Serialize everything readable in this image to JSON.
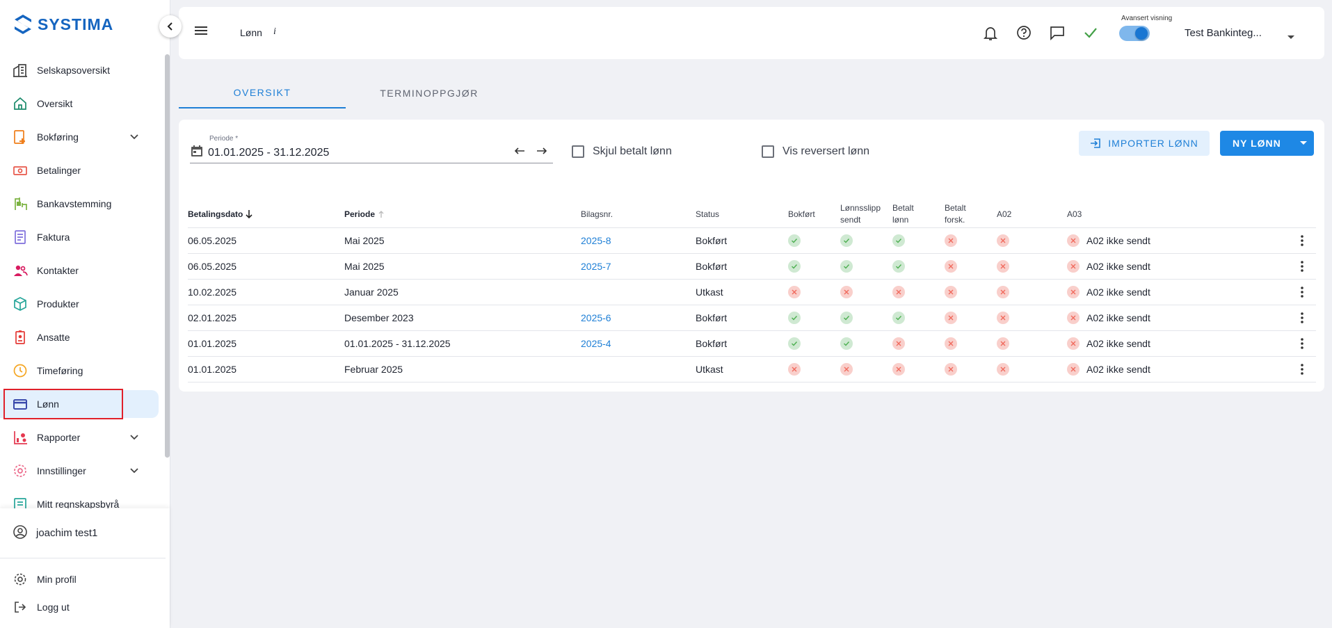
{
  "brand": {
    "name": "SYSTIMA",
    "color": "#1565c0"
  },
  "sidebar": {
    "items": [
      {
        "label": "Selskapsoversikt",
        "icon": "buildings-icon",
        "color": "#444444",
        "chevron": false
      },
      {
        "label": "Oversikt",
        "icon": "home-icon",
        "color": "#1b8a6b",
        "chevron": false
      },
      {
        "label": "Bokføring",
        "icon": "bookkeeping-icon",
        "color": "#ef7d18",
        "chevron": true
      },
      {
        "label": "Betalinger",
        "icon": "payments-icon",
        "color": "#e8574a",
        "chevron": false
      },
      {
        "label": "Bankavstemming",
        "icon": "reconcile-icon",
        "color": "#7cb342",
        "chevron": false
      },
      {
        "label": "Faktura",
        "icon": "invoice-icon",
        "color": "#7e6fdc",
        "chevron": false
      },
      {
        "label": "Kontakter",
        "icon": "contacts-icon",
        "color": "#d81b60",
        "chevron": false
      },
      {
        "label": "Produkter",
        "icon": "box-icon",
        "color": "#26a69a",
        "chevron": false
      },
      {
        "label": "Ansatte",
        "icon": "badge-icon",
        "color": "#e53935",
        "chevron": false
      },
      {
        "label": "Timeføring",
        "icon": "clock-icon",
        "color": "#f5a623",
        "chevron": false
      },
      {
        "label": "Lønn",
        "icon": "card-icon",
        "color": "#3949ab",
        "chevron": false,
        "active": true
      },
      {
        "label": "Rapporter",
        "icon": "chart-icon",
        "color": "#e53950",
        "chevron": true
      },
      {
        "label": "Innstillinger",
        "icon": "settings-icon",
        "color": "#ec6b8c",
        "chevron": true
      },
      {
        "label": "Mitt regnskapsbyrå",
        "icon": "agency-icon",
        "color": "#26a69a",
        "chevron": false
      }
    ],
    "user": "joachim test1",
    "profile": "Min profil",
    "logout": "Logg ut"
  },
  "header": {
    "title": "Lønn",
    "info": "i",
    "advanced_label": "Avansert visning",
    "advanced_on": true,
    "company": "Test Bankinteg..."
  },
  "tabs": [
    {
      "label": "OVERSIKT",
      "active": true
    },
    {
      "label": "TERMINOPPGJØR",
      "active": false
    }
  ],
  "filters": {
    "period_label": "Periode *",
    "period_value": "01.01.2025 - 31.12.2025",
    "hide_paid": "Skjul betalt lønn",
    "show_reversed": "Vis reversert lønn",
    "import_label": "IMPORTER LØNN",
    "new_label": "NY LØNN"
  },
  "table": {
    "headers": {
      "paydate": "Betalingsdato",
      "period": "Periode",
      "voucher": "Bilagsnr.",
      "status": "Status",
      "booked": "Bokført",
      "payslip_1": "Lønnsslipp",
      "payslip_2": "sendt",
      "paid_1": "Betalt",
      "paid_2": "lønn",
      "paid_adv_1": "Betalt",
      "paid_adv_2": "forsk.",
      "a02": "A02",
      "a03": "A03"
    },
    "rows": [
      {
        "paydate": "06.05.2025",
        "period": "Mai 2025",
        "voucher": "2025-8",
        "status": "Bokført",
        "booked": true,
        "payslip": true,
        "paid": true,
        "adv": false,
        "a02": false,
        "a03": "A02 ikke sendt"
      },
      {
        "paydate": "06.05.2025",
        "period": "Mai 2025",
        "voucher": "2025-7",
        "status": "Bokført",
        "booked": true,
        "payslip": true,
        "paid": true,
        "adv": false,
        "a02": false,
        "a03": "A02 ikke sendt"
      },
      {
        "paydate": "10.02.2025",
        "period": "Januar 2025",
        "voucher": "",
        "status": "Utkast",
        "booked": false,
        "payslip": false,
        "paid": false,
        "adv": false,
        "a02": false,
        "a03": "A02 ikke sendt"
      },
      {
        "paydate": "02.01.2025",
        "period": "Desember 2023",
        "voucher": "2025-6",
        "status": "Bokført",
        "booked": true,
        "payslip": true,
        "paid": true,
        "adv": false,
        "a02": false,
        "a03": "A02 ikke sendt"
      },
      {
        "paydate": "01.01.2025",
        "period": "01.01.2025 - 31.12.2025",
        "voucher": "2025-4",
        "status": "Bokført",
        "booked": true,
        "payslip": true,
        "paid": false,
        "adv": false,
        "a02": false,
        "a03": "A02 ikke sendt"
      },
      {
        "paydate": "01.01.2025",
        "period": "Februar 2025",
        "voucher": "",
        "status": "Utkast",
        "booked": false,
        "payslip": false,
        "paid": false,
        "adv": false,
        "a02": false,
        "a03": "A02 ikke sendt"
      }
    ]
  },
  "colors": {
    "accent": "#1e88e5",
    "ok": "#4caf50",
    "error": "#f06a5d",
    "highlight": "#e0202a"
  }
}
